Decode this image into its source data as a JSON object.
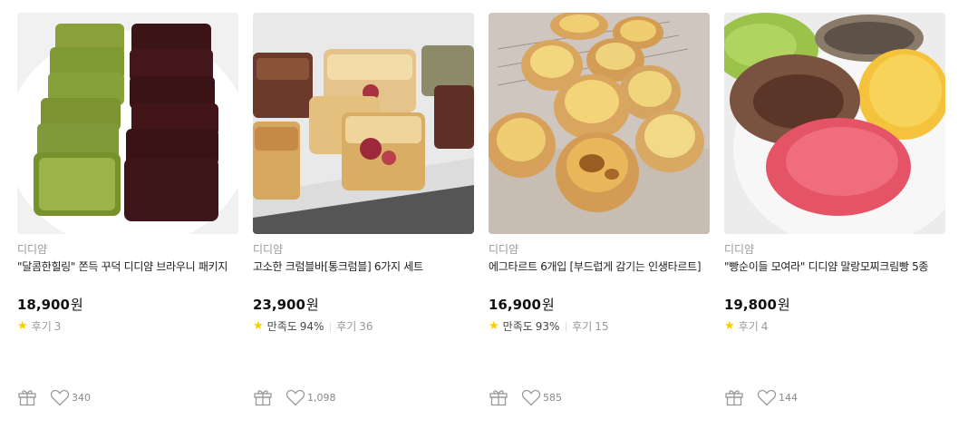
{
  "products": [
    {
      "brand": "디디얌",
      "title": "\"달콤한힐링\" 쫀득 꾸덕 디디얌 브라우니 패키지",
      "price": "18,900",
      "currency": "원",
      "satisfaction_label": "",
      "satisfaction_value": "",
      "review_label": "후기",
      "review_count": "3",
      "like_count": "340",
      "image_desc": "matcha and chocolate brownies"
    },
    {
      "brand": "디디얌",
      "title": "고소한 크럼블바[통크럼블] 6가지 세트",
      "price": "23,900",
      "currency": "원",
      "satisfaction_label": "만족도",
      "satisfaction_value": "94%",
      "review_label": "후기",
      "review_count": "36",
      "like_count": "1,098",
      "image_desc": "crumble bars"
    },
    {
      "brand": "디디얌",
      "title": "에그타르트 6개입 [부드럽게 감기는 인생타르트]",
      "price": "16,900",
      "currency": "원",
      "satisfaction_label": "만족도",
      "satisfaction_value": "93%",
      "review_label": "후기",
      "review_count": "15",
      "like_count": "585",
      "image_desc": "egg tarts"
    },
    {
      "brand": "디디얌",
      "title": "\"빵순이들 모여라\" 디디얌 말랑모찌크림빵 5종",
      "price": "19,800",
      "currency": "원",
      "satisfaction_label": "",
      "satisfaction_value": "",
      "review_label": "후기",
      "review_count": "4",
      "like_count": "144",
      "image_desc": "mochi cream buns"
    }
  ],
  "colors": {
    "star": "#ffcc00",
    "brand_text": "#999999",
    "icon_stroke": "#999999"
  },
  "icons": {
    "gift": "gift-icon",
    "like": "heart-icon",
    "star": "star-icon"
  }
}
